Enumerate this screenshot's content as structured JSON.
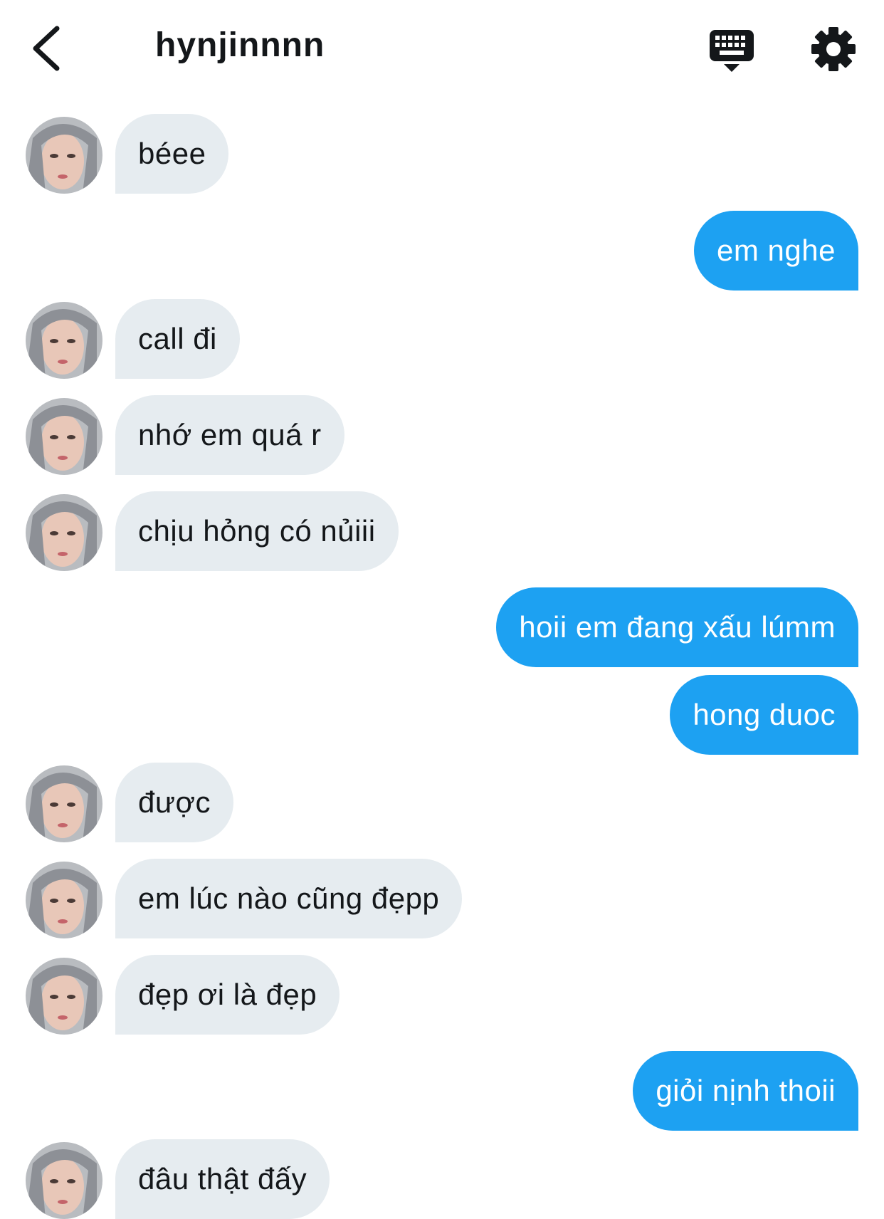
{
  "header": {
    "title": "hynjinnnn",
    "back_icon": "chevron-left-icon",
    "keyboard_icon": "keyboard-icon",
    "settings_icon": "gear-icon"
  },
  "colors": {
    "outgoing_bubble": "#1da1f2",
    "incoming_bubble": "#e6ecf0",
    "text": "#14171a"
  },
  "messages": [
    {
      "side": "in",
      "text": "béee"
    },
    {
      "side": "out",
      "text": "em nghe"
    },
    {
      "side": "in",
      "text": "call đi"
    },
    {
      "side": "in",
      "text": "nhớ em quá r"
    },
    {
      "side": "in",
      "text": "chịu hỏng có nủiii"
    },
    {
      "side": "out",
      "text": "hoii em đang xấu lúmm"
    },
    {
      "side": "out",
      "text": "hong duoc"
    },
    {
      "side": "in",
      "text": "được"
    },
    {
      "side": "in",
      "text": "em lúc nào cũng đẹpp"
    },
    {
      "side": "in",
      "text": "đẹp ơi là đẹp"
    },
    {
      "side": "out",
      "text": "giỏi nịnh thoii"
    },
    {
      "side": "in",
      "text": "đâu thật đấy"
    }
  ]
}
